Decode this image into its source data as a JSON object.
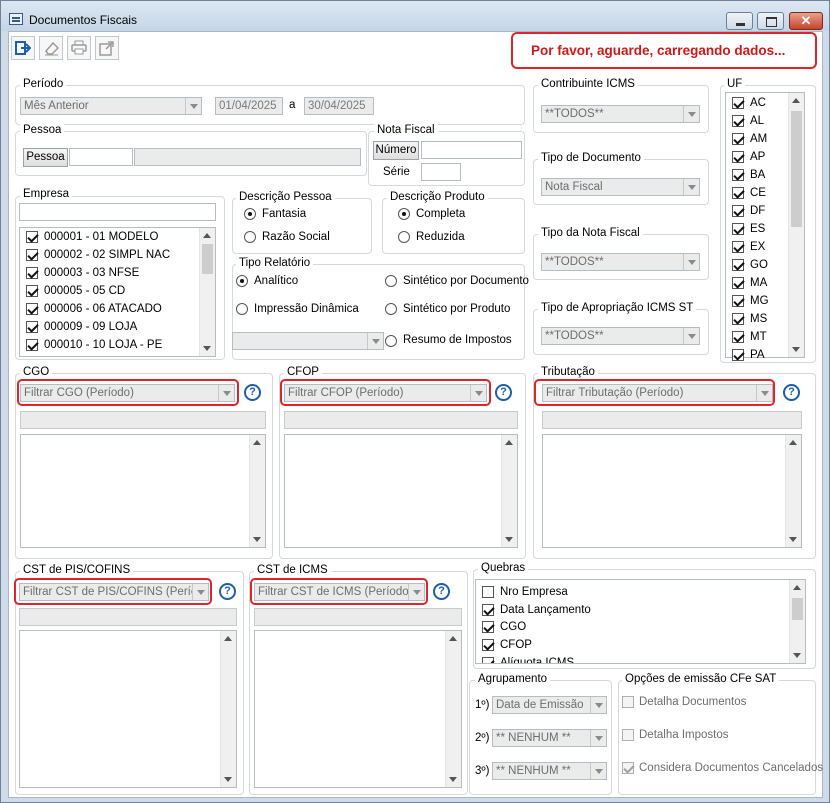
{
  "window": {
    "title": "Documentos Fiscais"
  },
  "toolbar": {
    "buttons": [
      {
        "name": "exit-icon"
      },
      {
        "name": "eraser-icon"
      },
      {
        "name": "printer-icon"
      },
      {
        "name": "export-icon"
      }
    ]
  },
  "loading_message": "Por favor, aguarde, carregando dados...",
  "periodo": {
    "label": "Período",
    "option": "Mês Anterior",
    "date_from": "01/04/2025",
    "separator": "a",
    "date_to": "30/04/2025"
  },
  "pessoa": {
    "label": "Pessoa",
    "button": "Pessoa"
  },
  "nota_fiscal": {
    "label": "Nota Fiscal",
    "numero_button": "Número",
    "serie_label": "Série"
  },
  "contribuinte_icms": {
    "label": "Contribuinte ICMS",
    "value": "**TODOS**"
  },
  "tipo_documento": {
    "label": "Tipo de Documento",
    "value": "Nota Fiscal"
  },
  "tipo_nota": {
    "label": "Tipo da Nota Fiscal",
    "value": "**TODOS**"
  },
  "tipo_apropriacao": {
    "label": "Tipo de Apropriação ICMS ST",
    "value": "**TODOS**"
  },
  "uf": {
    "label": "UF",
    "items": [
      "AC",
      "AL",
      "AM",
      "AP",
      "BA",
      "CE",
      "DF",
      "ES",
      "EX",
      "GO",
      "MA",
      "MG",
      "MS",
      "MT",
      "PA"
    ]
  },
  "empresa": {
    "label": "Empresa",
    "items": [
      "000001 - 01 MODELO",
      "000002 - 02 SIMPL NAC",
      "000003 - 03 NFSE",
      "000005 - 05 CD",
      "000006 - 06 ATACADO",
      "000009 - 09 LOJA",
      "000010 - 10 LOJA - PE"
    ]
  },
  "descricao_pessoa": {
    "label": "Descrição Pessoa",
    "options": [
      "Fantasia",
      "Razão Social"
    ],
    "selected": 0
  },
  "descricao_produto": {
    "label": "Descrição Produto",
    "options": [
      "Completa",
      "Reduzida"
    ],
    "selected": 0
  },
  "tipo_relatorio": {
    "label": "Tipo Relatório",
    "options": [
      "Analítico",
      "Sintético por Documento",
      "Impressão Dinâmica",
      "Sintético por Produto",
      "Resumo de Impostos"
    ],
    "selected": 0
  },
  "cgo": {
    "label": "CGO",
    "filter": "Filtrar CGO (Período)",
    "help": "?"
  },
  "cfop": {
    "label": "CFOP",
    "filter": "Filtrar CFOP (Período)",
    "help": "?"
  },
  "tributacao": {
    "label": "Tributação",
    "filter": "Filtrar Tributação (Período)",
    "help": "?"
  },
  "cst_pis": {
    "label": "CST de PIS/COFINS",
    "filter": "Filtrar CST de PIS/COFINS (Período)",
    "help": "?"
  },
  "cst_icms": {
    "label": "CST de ICMS",
    "filter": "Filtrar CST de ICMS (Período)",
    "help": "?"
  },
  "quebras": {
    "label": "Quebras",
    "items": [
      {
        "text": "Nro Empresa",
        "checked": false
      },
      {
        "text": "Data Lançamento",
        "checked": true
      },
      {
        "text": "CGO",
        "checked": true
      },
      {
        "text": "CFOP",
        "checked": true
      },
      {
        "text": "Alíquota ICMS",
        "checked": true
      }
    ]
  },
  "agrupamento": {
    "label": "Agrupamento",
    "rows": [
      {
        "ord": "1º)",
        "value": "Data de Emissão"
      },
      {
        "ord": "2º)",
        "value": "** NENHUM **"
      },
      {
        "ord": "3º)",
        "value": "** NENHUM **"
      }
    ]
  },
  "cfe_sat": {
    "label": "Opções de emissão CFe SAT",
    "items": [
      {
        "text": "Detalha Documentos",
        "checked": false
      },
      {
        "text": "Detalha Impostos",
        "checked": false
      },
      {
        "text": "Considera Documentos Cancelados",
        "checked": true
      }
    ]
  },
  "colors": {
    "accent_red": "#e0242b",
    "help_blue": "#1d5fa8"
  }
}
